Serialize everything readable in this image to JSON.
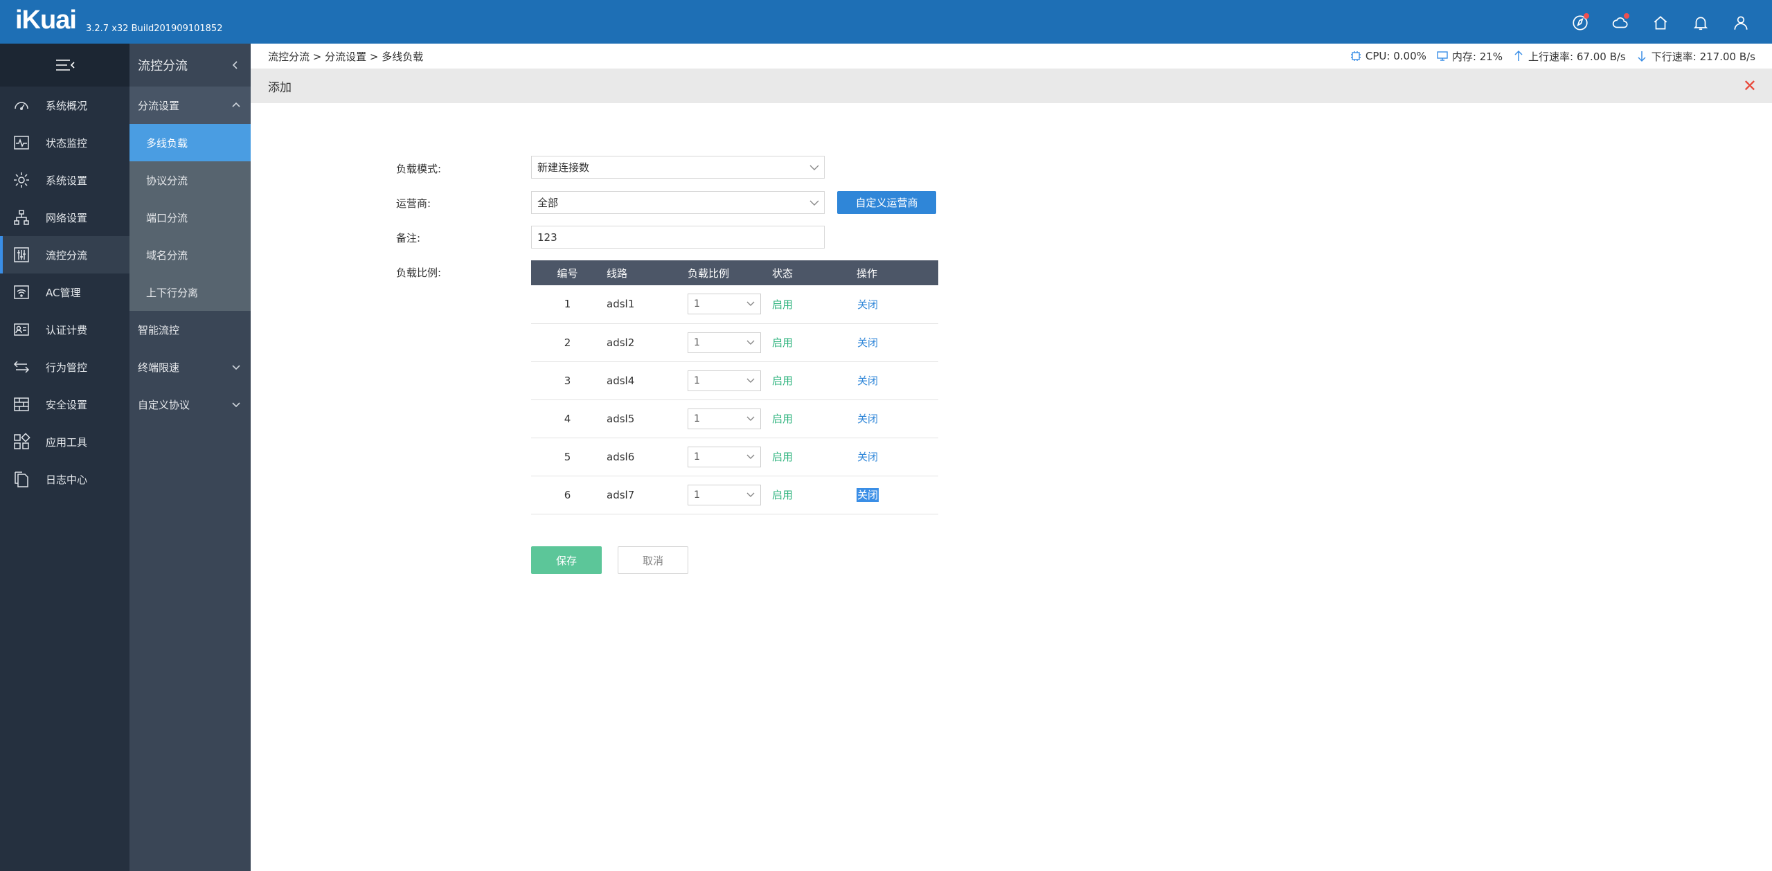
{
  "app": {
    "logo": "iKuai",
    "build": "3.2.7 x32 Build201909101852"
  },
  "colors": {
    "topbar": "#1e6fb5",
    "nav_primary": "#25303f",
    "nav_secondary": "#3a4656",
    "active_sub": "#4a9de2",
    "enable_green": "#2db37d",
    "link_blue": "#2f86d8",
    "close_red": "#e8483a",
    "save_green": "#5cc699"
  },
  "top_icons": [
    "compass-icon",
    "cloud-icon",
    "home-icon",
    "bell-icon",
    "user-icon"
  ],
  "nav_primary": [
    {
      "label": "系统概况",
      "icon": "dashboard-icon"
    },
    {
      "label": "状态监控",
      "icon": "pulse-icon"
    },
    {
      "label": "系统设置",
      "icon": "gear-icon"
    },
    {
      "label": "网络设置",
      "icon": "network-icon"
    },
    {
      "label": "流控分流",
      "icon": "sliders-icon",
      "active": true
    },
    {
      "label": "AC管理",
      "icon": "wifi-icon"
    },
    {
      "label": "认证计费",
      "icon": "id-card-icon"
    },
    {
      "label": "行为管控",
      "icon": "arrows-icon"
    },
    {
      "label": "安全设置",
      "icon": "firewall-icon"
    },
    {
      "label": "应用工具",
      "icon": "apps-icon"
    },
    {
      "label": "日志中心",
      "icon": "document-icon"
    }
  ],
  "nav_secondary": {
    "title": "流控分流",
    "group": "分流设置",
    "sub_items": [
      "多线负载",
      "协议分流",
      "端口分流",
      "域名分流",
      "上下行分离"
    ],
    "active_sub": "多线负载",
    "other_items": [
      {
        "label": "智能流控",
        "expandable": false
      },
      {
        "label": "终端限速",
        "expandable": true
      },
      {
        "label": "自定义协议",
        "expandable": true
      }
    ]
  },
  "breadcrumb": "流控分流 > 分流设置 > 多线负载",
  "stats": {
    "cpu": "CPU: 0.00%",
    "mem": "内存: 21%",
    "up": "上行速率: 67.00 B/s",
    "down": "下行速率: 217.00 B/s"
  },
  "panel_title": "添加",
  "form": {
    "mode_label": "负载模式:",
    "mode_value": "新建连接数",
    "isp_label": "运营商:",
    "isp_value": "全部",
    "custom_isp_button": "自定义运营商",
    "note_label": "备注:",
    "note_value": "123",
    "ratio_label": "负载比例:"
  },
  "table": {
    "headers": [
      "编号",
      "线路",
      "负载比例",
      "状态",
      "操作"
    ],
    "rows": [
      {
        "id": "1",
        "line": "adsl1",
        "ratio": "1",
        "status": "启用",
        "action": "关闭"
      },
      {
        "id": "2",
        "line": "adsl2",
        "ratio": "1",
        "status": "启用",
        "action": "关闭"
      },
      {
        "id": "3",
        "line": "adsl4",
        "ratio": "1",
        "status": "启用",
        "action": "关闭"
      },
      {
        "id": "4",
        "line": "adsl5",
        "ratio": "1",
        "status": "启用",
        "action": "关闭"
      },
      {
        "id": "5",
        "line": "adsl6",
        "ratio": "1",
        "status": "启用",
        "action": "关闭"
      },
      {
        "id": "6",
        "line": "adsl7",
        "ratio": "1",
        "status": "启用",
        "action": "关闭"
      }
    ]
  },
  "buttons": {
    "save": "保存",
    "cancel": "取消"
  }
}
